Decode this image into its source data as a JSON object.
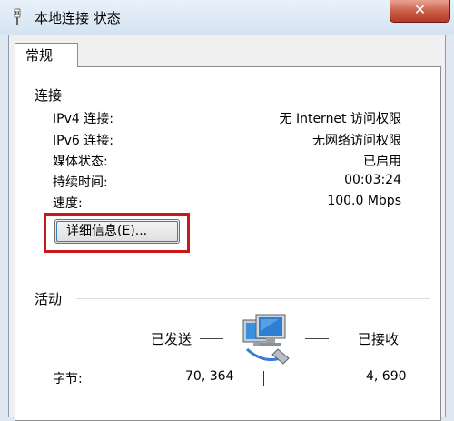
{
  "window": {
    "title": "本地连接 状态",
    "close_glyph": "✕"
  },
  "tabs": [
    {
      "label": "常规",
      "selected": true
    }
  ],
  "connection": {
    "group_title": "连接",
    "rows": [
      {
        "label": "IPv4 连接:",
        "value": "无 Internet 访问权限"
      },
      {
        "label": "IPv6 连接:",
        "value": "无网络访问权限"
      },
      {
        "label": "媒体状态:",
        "value": "已启用"
      },
      {
        "label": "持续时间:",
        "value": "00:03:24"
      },
      {
        "label": "速度:",
        "value": "100.0 Mbps"
      }
    ],
    "details_button": "详细信息(E)..."
  },
  "activity": {
    "group_title": "活动",
    "sent_label": "已发送",
    "received_label": "已接收",
    "bytes_label": "字节:",
    "bytes_sent": "70, 364",
    "bytes_received": "4, 690"
  },
  "colors": {
    "highlight_outline": "#c91818",
    "close_button": "#c85a45"
  },
  "icons": {
    "title": "network-plug-icon",
    "activity": "network-computers-icon"
  }
}
